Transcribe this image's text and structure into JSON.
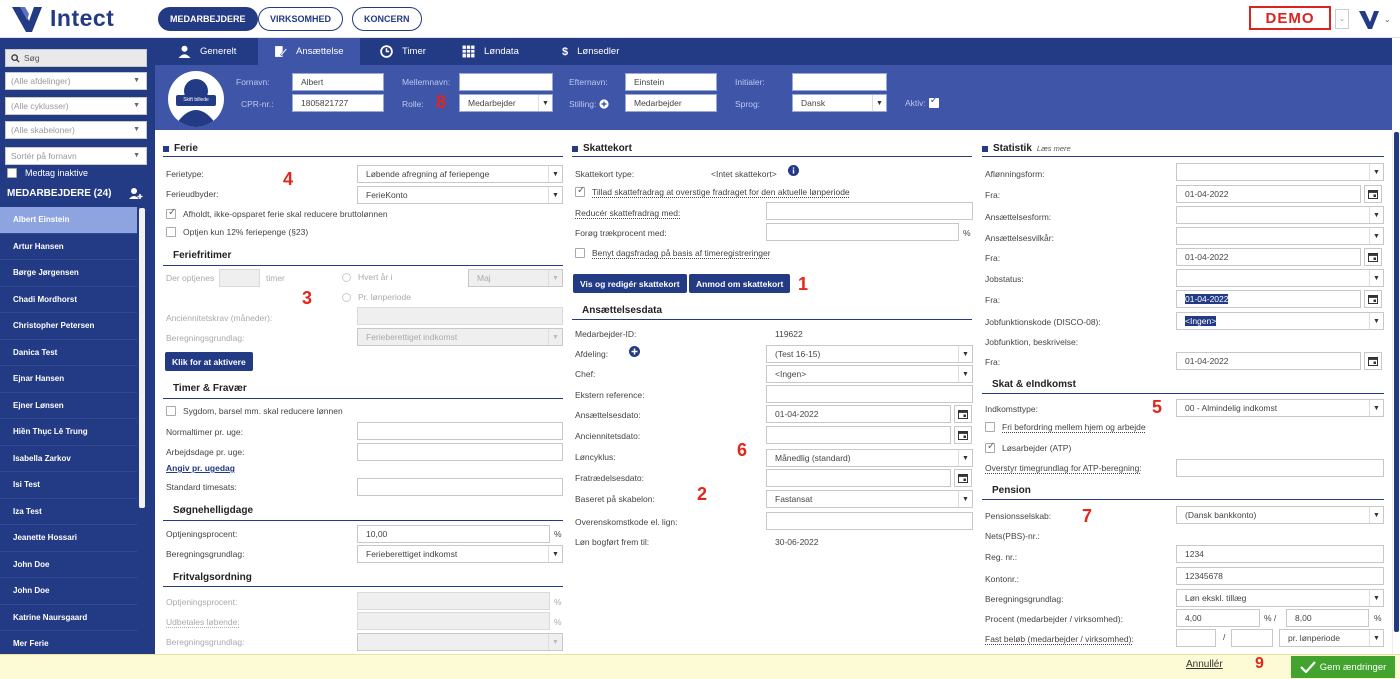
{
  "brand": {
    "name": "Intect",
    "color": "#233a84"
  },
  "top_tabs": [
    {
      "label": "MEDARBEJDERE"
    },
    {
      "label": "VIRKSOMHED"
    },
    {
      "label": "KONCERN"
    }
  ],
  "demo_badge": "DEMO",
  "sidebar": {
    "search_placeholder": "Søg",
    "filters": [
      "(Alle afdelinger)",
      "(Alle cyklusser)",
      "(Alle skabeloner)",
      "Sortér på fornavn"
    ],
    "include_inactive": "Medtag inaktive",
    "list_title": "MEDARBEJDERE (24)",
    "employees": [
      "Albert Einstein",
      "Artur Hansen",
      "Børge Jørgensen",
      "Chadi Mordhorst",
      "Christopher Petersen",
      "Danica Test",
      "Ejnar Hansen",
      "Ejner Lønsen",
      "Hiền Thục Lê Trung",
      "Isabella Zarkov",
      "Isi Test",
      "Iza Test",
      "Jeanette Hossari",
      "John Doe",
      "John Doe",
      "Katrine Naursgaard",
      "Mer Ferie"
    ]
  },
  "subtabs": [
    {
      "label": "Generelt"
    },
    {
      "label": "Ansættelse"
    },
    {
      "label": "Timer"
    },
    {
      "label": "Løndata"
    },
    {
      "label": "Lønsedler"
    }
  ],
  "profile": {
    "avatar_text": "Skift billede",
    "fornavn_label": "Fornavn:",
    "fornavn": "Albert",
    "mellemnavn_label": "Mellemnavn:",
    "mellemnavn": "",
    "efternavn_label": "Efternavn:",
    "efternavn": "Einstein",
    "initialer_label": "Initialer:",
    "initialer": "",
    "cpr_label": "CPR-nr.:",
    "cpr": "1805821727",
    "rolle_label": "Rolle:",
    "rolle": "Medarbejder",
    "stilling_label": "Stilling:",
    "stilling": "Medarbejder",
    "sprog_label": "Sprog:",
    "sprog": "Dansk",
    "aktiv_label": "Aktiv:"
  },
  "annotations": {
    "n1": "1",
    "n2": "2",
    "n3": "3",
    "n4": "4",
    "n5": "5",
    "n6": "6",
    "n7": "7",
    "n8": "8",
    "n9": "9"
  },
  "ferie": {
    "title": "Ferie",
    "feriatype_label": "Ferietype:",
    "feriatype": "Løbende afregning af feriepenge",
    "ferieudbyder_label": "Ferieudbyder:",
    "ferieudbyder": "FerieKonto",
    "check1": "Afholdt, ikke-opsparet ferie skal reducere bruttolønnen",
    "check2": "Optjen kun 12% feriepenge (§23)",
    "feriefritimer_title": "Feriefritimer",
    "der_optjenes": "Der optjenes",
    "timer": "timer",
    "hvert_aar": "Hvert år i",
    "month": "Maj",
    "pr_loenperiode": "Pr. lønperiode",
    "anciennitet_label": "Anciennitetskrav (måneder):",
    "beregning_label": "Beregningsgrundlag:",
    "beregning_val": "Ferieberettiget indkomst",
    "activate_btn": "Klik for at aktivere",
    "timer_fravaer_title": "Timer & Fravær",
    "sygdom": "Sygdom, barsel mm. skal reducere lønnen",
    "normaltimer": "Normaltimer pr. uge:",
    "arbejdsdage": "Arbejdsdage pr. uge:",
    "angiv": "Angiv pr. ugedag",
    "standard_timesats": "Standard timesats:",
    "soegnehelligdage_title": "Søgnehelligdage",
    "optjeningsprocent_label": "Optjeningsprocent:",
    "optjeningsprocent": "10,00",
    "beregning2_label": "Beregningsgrundlag:",
    "beregning2": "Ferieberettiget indkomst",
    "fritvalg_title": "Fritvalgsordning",
    "fritvalg_optjening": "Optjeningsprocent:",
    "fritvalg_udbetales": "Udbetales løbende:",
    "fritvalg_beregning": "Beregningsgrundlag:",
    "pct": "%"
  },
  "skat": {
    "title": "Skattekort",
    "type_label": "Skattekort type:",
    "type_val": "<Intet skattekort>",
    "tillad": "Tillad skattefradrag at overstige fradraget for den aktuelle lønperiode",
    "reducer": "Reducér skattefradrag med:",
    "foroeg": "Forøg trækprocent med:",
    "benyt": "Benyt dagsfradag på basis af timeregistreringer",
    "btn_vis": "Vis og redigér skattekort",
    "btn_anmod": "Anmod om skattekort",
    "pct": "%"
  },
  "ansaettelse": {
    "title": "Ansættelsesdata",
    "medarbejder_id_label": "Medarbejder-ID:",
    "medarbejder_id": "119622",
    "afdeling_label": "Afdeling:",
    "afdeling": "(Test 16-15)",
    "chef_label": "Chef:",
    "chef": "<Ingen>",
    "ekstern_label": "Ekstern reference:",
    "ansaettelsesdato_label": "Ansættelsesdato:",
    "ansaettelsesdato": "01-04-2022",
    "anciennitetsdato_label": "Anciennitetsdato:",
    "loencyklus_label": "Løncyklus:",
    "loencyklus": "Månedlig (standard)",
    "fratraedelse_label": "Fratrædelsesdato:",
    "skabelon_label": "Baseret på skabelon:",
    "skabelon": "Fastansat",
    "overenskomst_label": "Overenskomstkode el. lign:",
    "loen_bogfoert_label": "Løn bogført frem til:",
    "loen_bogfoert": "30-06-2022"
  },
  "statistik": {
    "title": "Statistik",
    "laes_mere": "Læs mere",
    "afloenning_label": "Aflønningsform:",
    "fra_label": "Fra:",
    "fra1": "01-04-2022",
    "ansaettelsesform_label": "Ansættelsesform:",
    "ansaettelsesvilkaar_label": "Ansættelsesvilkår:",
    "fra2": "01-04-2022",
    "jobstatus_label": "Jobstatus:",
    "fra3": "01-04-2022",
    "disco_label": "Jobfunktionskode (DISCO-08):",
    "disco": "<Ingen>",
    "jobfunktion_label": "Jobfunktion, beskrivelse:",
    "fra4": "01-04-2022"
  },
  "skat_indkomst": {
    "title": "Skat & eIndkomst",
    "indkomsttype_label": "Indkomsttype:",
    "indkomsttype": "00 - Almindelig indkomst",
    "fri_befordring": "Fri befordring mellem hjem og arbejde",
    "loesarbejder": "Løsarbejder (ATP)",
    "overstyr": "Overstyr timegrundlag for ATP-beregning:"
  },
  "pension": {
    "title": "Pension",
    "selskab_label": "Pensionsselskab:",
    "selskab": "(Dansk bankkonto)",
    "nets_label": "Nets(PBS)-nr.:",
    "reg_label": "Reg. nr.:",
    "reg": "1234",
    "konto_label": "Kontonr.:",
    "konto": "12345678",
    "beregning_label": "Beregningsgrundlag:",
    "beregning": "Løn ekskl. tillæg",
    "procent_label": "Procent (medarbejder / virksomhed):",
    "procent_med": "4,00",
    "procent_virk": "8,00",
    "pct_sep": "% /",
    "pct": "%",
    "fast_label": "Fast beløb (medarbejder / virksomhed):",
    "fast_sep": "/",
    "fast_periode": "pr. lønperiode"
  },
  "footer": {
    "annuller": "Annullér",
    "gem": "Gem ændringer"
  },
  "colors": {
    "navy": "#233a84",
    "mid_blue": "#3e55a8",
    "highlight": "#8ea4e0",
    "red": "#e3261b",
    "green": "#43a32f",
    "footer_bg": "#fdfbd6"
  }
}
